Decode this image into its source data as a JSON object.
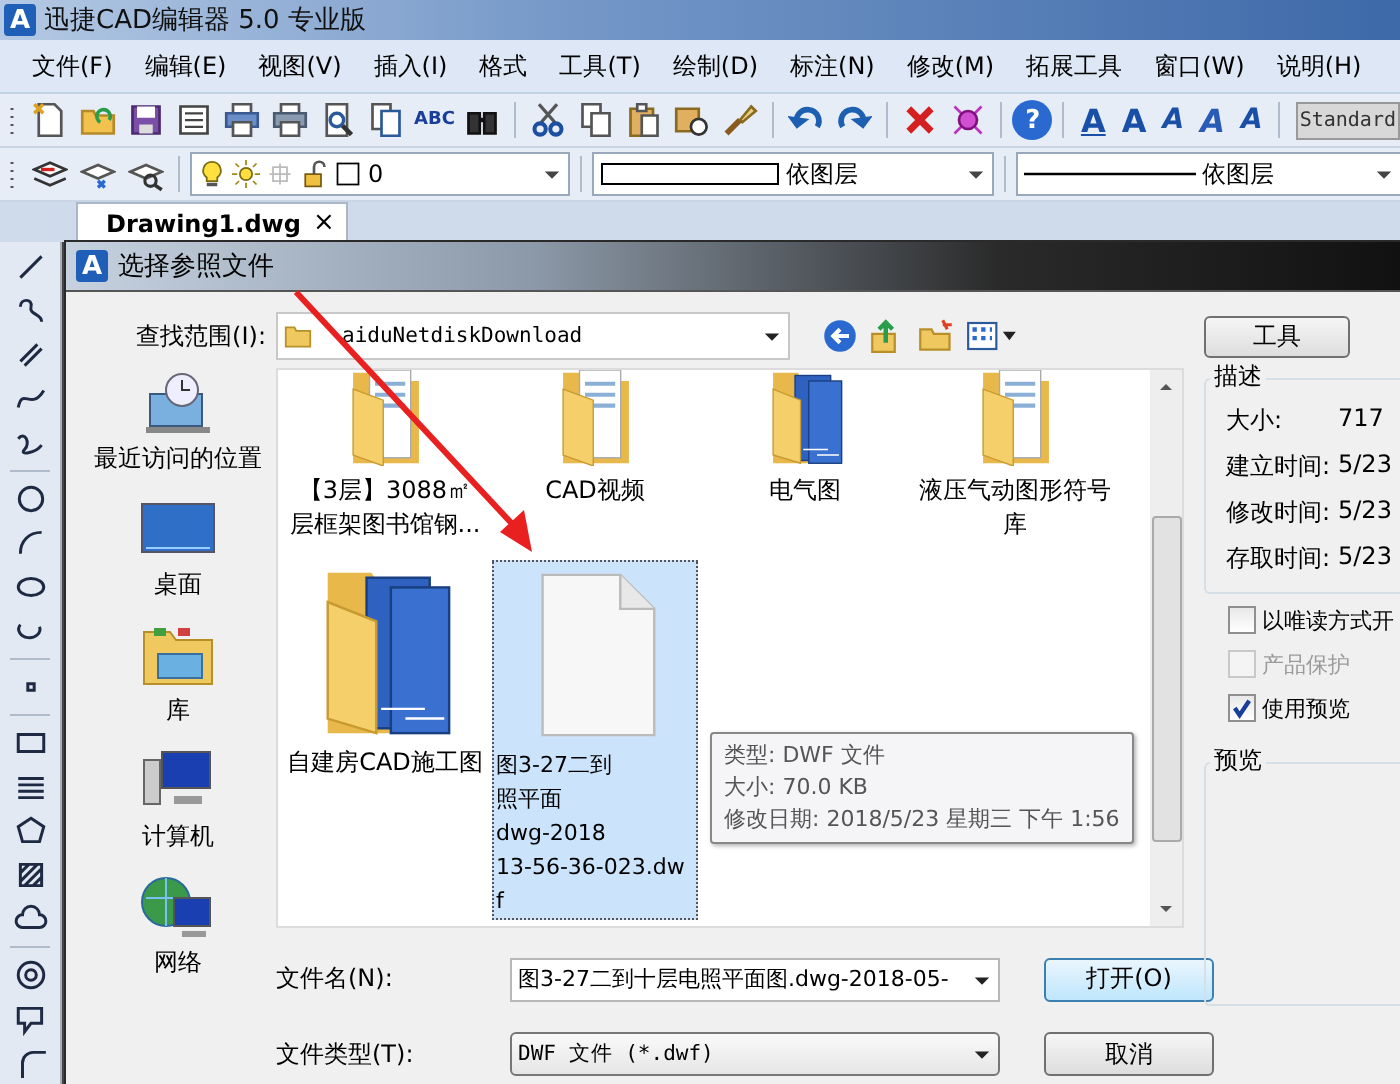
{
  "window": {
    "logo_glyph": "A",
    "title": "迅捷CAD编辑器 5.0 专业版"
  },
  "menu": [
    "文件(F)",
    "编辑(E)",
    "视图(V)",
    "插入(I)",
    "格式",
    "工具(T)",
    "绘制(D)",
    "标注(N)",
    "修改(M)",
    "拓展工具",
    "窗口(W)",
    "说明(H)"
  ],
  "toolbar": {
    "spell_check_glyph": "ABC",
    "help_glyph": "?",
    "text_glyphs": [
      "A",
      "A",
      "A",
      "A",
      "A"
    ],
    "style_combo": "Standard"
  },
  "properties_bar": {
    "layer": "0",
    "color_setting": "依图层",
    "linetype": "依图层"
  },
  "tabs": [
    {
      "label": "Drawing1.dwg",
      "close": "×",
      "selected": true
    }
  ],
  "dialog": {
    "logo_glyph": "A",
    "title": "选择参照文件",
    "look_in_label": "查找范围(I):",
    "look_in": "aiduNetdiskDownload",
    "places": [
      {
        "kind": "recent",
        "label": "最近访问的位置"
      },
      {
        "kind": "desktop",
        "label": "桌面"
      },
      {
        "kind": "library",
        "label": "库"
      },
      {
        "kind": "computer",
        "label": "计算机"
      },
      {
        "kind": "network",
        "label": "网络"
      }
    ],
    "files": [
      {
        "kind": "folder",
        "lines": [
          "【3层】3088㎡",
          "层框架图书馆钢..."
        ],
        "selected": false
      },
      {
        "kind": "folder",
        "lines": [
          "CAD视频"
        ],
        "selected": false
      },
      {
        "kind": "cad_folder",
        "lines": [
          "电气图"
        ],
        "selected": false
      },
      {
        "kind": "folder",
        "lines": [
          "液压气动图形符号",
          "库"
        ],
        "selected": false
      },
      {
        "kind": "cad_folder",
        "lines": [
          "自建房CAD施工图"
        ],
        "selected": false
      },
      {
        "kind": "file",
        "lines": [
          "图3-27二到",
          "照平面",
          "dwg-2018",
          "13-56-36-023.dw",
          "f"
        ],
        "selected": true
      }
    ],
    "tooltip": [
      "类型: DWF 文件",
      "大小: 70.0 KB",
      "修改日期: 2018/5/23 星期三 下午 1:56"
    ],
    "file_name_label": "文件名(N):",
    "file_name": "图3-27二到十层电照平面图.dwg-2018-05-",
    "file_type_label": "文件类型(T):",
    "file_type": "DWF 文件 (*.dwf)",
    "open_button": "打开(O)",
    "cancel_button": "取消",
    "tools_button": "工具",
    "description": {
      "title": "描述",
      "rows": [
        {
          "label": "大小:",
          "value": "717"
        },
        {
          "label": "建立时间:",
          "value": "5/23"
        },
        {
          "label": "修改时间:",
          "value": "5/23"
        },
        {
          "label": "存取时间:",
          "value": "5/23"
        }
      ]
    },
    "options": [
      {
        "label": "以唯读方式开",
        "checked": false,
        "disabled": false
      },
      {
        "label": "产品保护",
        "checked": false,
        "disabled": true
      },
      {
        "label": "使用预览",
        "checked": true,
        "disabled": false
      }
    ],
    "preview_title": "预览"
  }
}
